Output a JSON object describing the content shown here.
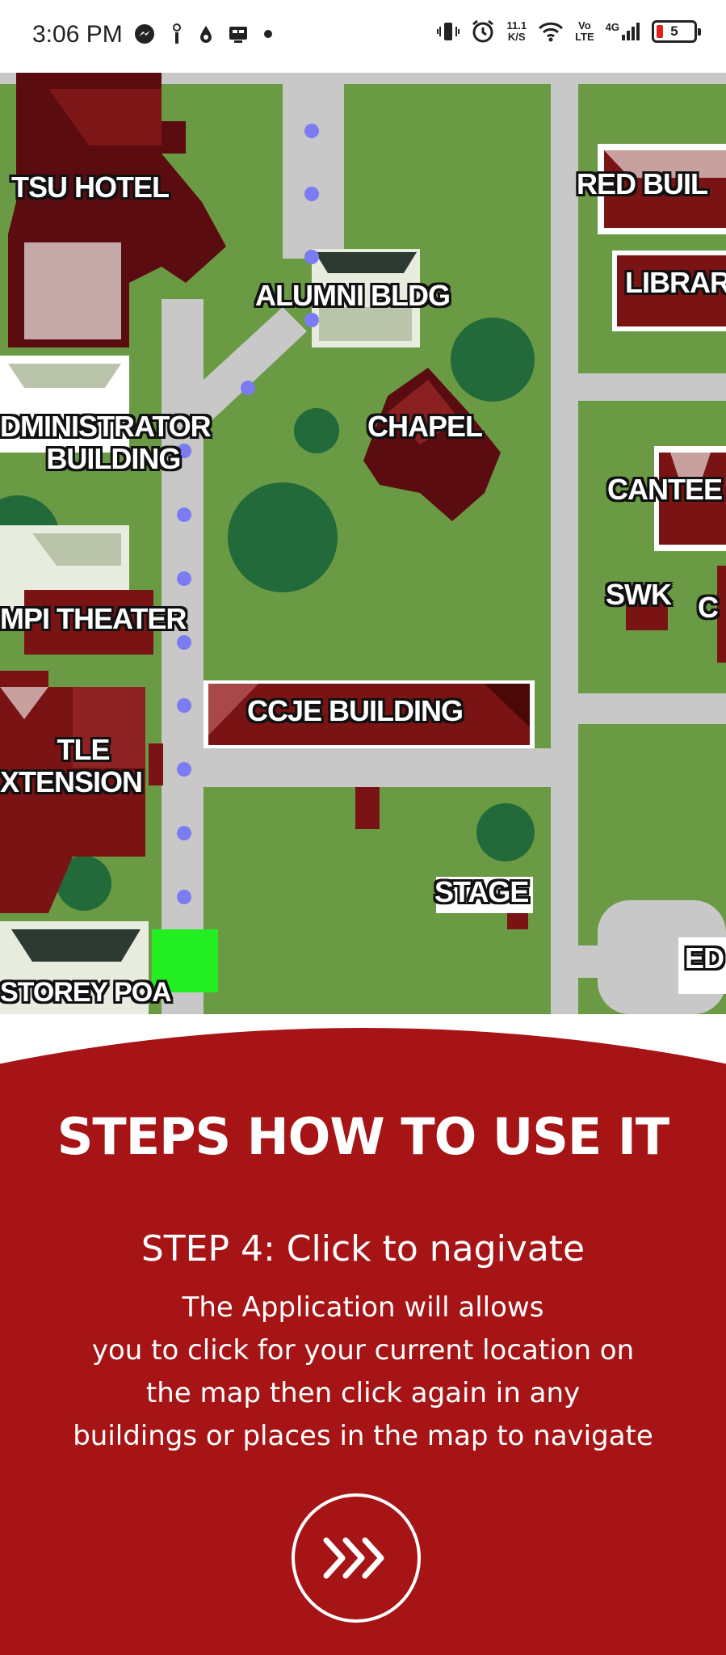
{
  "status_bar": {
    "time": "3:06 PM",
    "net_speed_value": "11.1",
    "net_speed_unit": "K/S",
    "volte_top": "Vo",
    "volte_bottom": "LTE",
    "network": "4G",
    "battery": "5",
    "icons": [
      "messenger-icon",
      "info-icon",
      "drop-icon",
      "media-icon",
      "dot-icon",
      "vibrate-icon",
      "alarm-icon",
      "wifi-icon",
      "signal-icon",
      "battery-icon"
    ]
  },
  "map": {
    "labels": {
      "tsu_hotel": "TSU HOTEL",
      "alumni_bldg": "ALUMNI BLDG",
      "red_building": "RED BUIL",
      "library": "LIBRAR",
      "administrator_building_1": "DMINISTRATOR",
      "administrator_building_2": "BUILDING",
      "chapel": "CHAPEL",
      "canteen": "CANTEE",
      "swk": "SWK",
      "c_building": "C",
      "theater": "MPI THEATER",
      "ccje_building": "CCJE BUILDING",
      "tle_extension_1": "TLE",
      "tle_extension_2": "XTENSION",
      "stage": "STAGE",
      "storey": "STOREY POA",
      "ed": "ED"
    },
    "colors": {
      "grass": "#6a9a44",
      "road": "#c8c8c8",
      "building_red": "#7a1414",
      "route_dot": "#7b7bf2",
      "current_location": "#22ee22"
    }
  },
  "panel": {
    "title": "STEPS HOW TO USE IT",
    "step_title": "STEP 4: Click to nagivate",
    "description_lines": [
      "The Application will allows",
      "you to click for your current location on",
      "the map then click again in any",
      "buildings or places in the map  to navigate"
    ],
    "next_icon": "triple-chevron-right-icon",
    "background": "#a61416"
  }
}
